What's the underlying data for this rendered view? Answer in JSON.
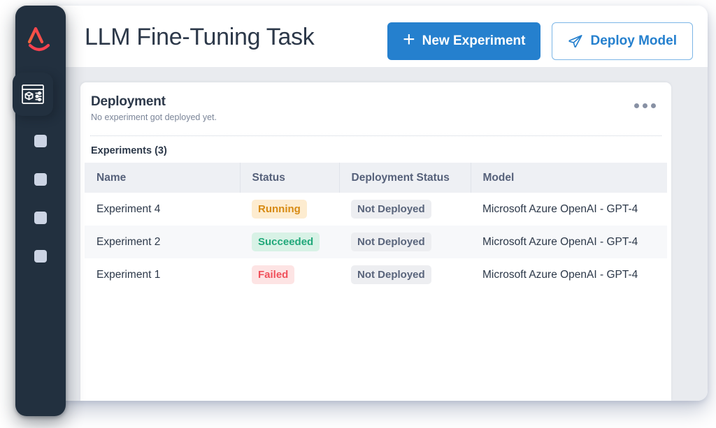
{
  "app": {
    "logo_text": "AI",
    "logo_colors": {
      "gradient_start": "#f2683c",
      "gradient_end": "#f73b52",
      "smile": "#f7414f"
    },
    "window_bg": "#ffffff",
    "sidebar_bg": "#22303f",
    "body_bg": "#e9ebef",
    "accent": "#2580ce"
  },
  "sidebar": {
    "active_item": {
      "name": "model-deployments",
      "icon": "window-cube-sliders-icon"
    },
    "items": [
      {
        "name": "nav-item-1",
        "icon": "square-placeholder-icon"
      },
      {
        "name": "nav-item-2",
        "icon": "square-placeholder-icon"
      },
      {
        "name": "nav-item-3",
        "icon": "square-placeholder-icon"
      },
      {
        "name": "nav-item-4",
        "icon": "square-placeholder-icon"
      }
    ]
  },
  "header": {
    "title": "LLM Fine-Tuning Task",
    "new_experiment_label": "New Experiment",
    "new_experiment_icon": "plus-icon",
    "deploy_model_label": "Deploy Model",
    "deploy_model_icon": "paper-plane-icon"
  },
  "card": {
    "title": "Deployment",
    "subtitle": "No experiment got deployed yet.",
    "overflow_icon": "ellipsis-icon",
    "section_label": "Experiments (3)"
  },
  "table": {
    "columns": [
      "Name",
      "Status",
      "Deployment Status",
      "Model"
    ],
    "rows": [
      {
        "name": "Experiment 4",
        "status": "Running",
        "status_kind": "running",
        "deployment_status": "Not Deployed",
        "model": "Microsoft Azure OpenAI - GPT-4"
      },
      {
        "name": "Experiment 2",
        "status": "Succeeded",
        "status_kind": "succeeded",
        "deployment_status": "Not Deployed",
        "model": "Microsoft Azure OpenAI - GPT-4"
      },
      {
        "name": "Experiment 1",
        "status": "Failed",
        "status_kind": "failed",
        "deployment_status": "Not Deployed",
        "model": "Microsoft Azure OpenAI - GPT-4"
      }
    ],
    "status_colors": {
      "running_bg": "#fdecd0",
      "running_fg": "#d78a12",
      "succeeded_bg": "#d8f2e6",
      "succeeded_fg": "#21a87a",
      "failed_bg": "#fde4e4",
      "failed_fg": "#f0515b",
      "neutral_bg": "#edeef1",
      "neutral_fg": "#59647b"
    }
  }
}
